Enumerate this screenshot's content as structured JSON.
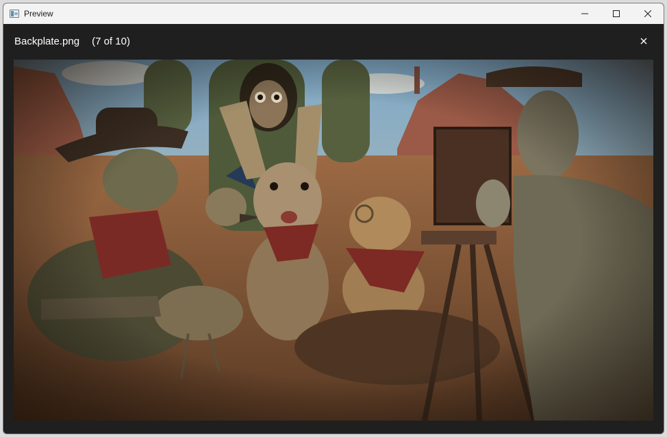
{
  "window": {
    "title": "Preview",
    "icon": "app-preview-icon",
    "controls": [
      "minimize-icon",
      "maximize-icon",
      "close-icon"
    ]
  },
  "viewer": {
    "file_name": "Backplate.png",
    "position": "(7 of 10)",
    "close_icon": "close-icon"
  },
  "colors": {
    "titlebar": "#f3f3f3",
    "viewer_background": "#1f1f1f",
    "header_text": "#ffffff"
  }
}
